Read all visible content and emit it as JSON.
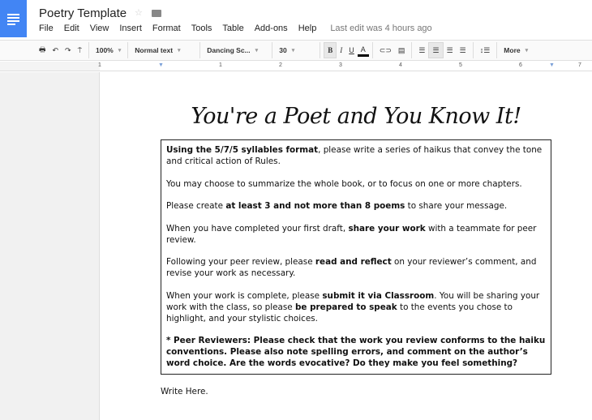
{
  "app": {
    "title": "Poetry Template",
    "last_edit": "Last edit was 4 hours ago"
  },
  "menu": [
    "File",
    "Edit",
    "View",
    "Insert",
    "Format",
    "Tools",
    "Table",
    "Add-ons",
    "Help"
  ],
  "toolbar": {
    "zoom": "100%",
    "style": "Normal text",
    "font": "Dancing Sc...",
    "size": "30",
    "bold": "B",
    "italic": "I",
    "underline": "U",
    "text_color": "A",
    "more": "More",
    "text_color_value": "#000000"
  },
  "ruler": [
    "1",
    "1",
    "2",
    "3",
    "4",
    "5",
    "6",
    "7"
  ],
  "doc": {
    "heading": "You're a Poet and You Know It!",
    "paragraphs": [
      [
        {
          "t": "Using the 5/7/5 syllables format",
          "b": true
        },
        {
          "t": ", please write a series of haikus that convey the tone and critical action of Rules."
        }
      ],
      [
        {
          "t": "You may choose to summarize the whole book, or to focus on one or more chapters."
        }
      ],
      [
        {
          "t": "Please create "
        },
        {
          "t": "at least 3 and not more than 8 poems",
          "b": true
        },
        {
          "t": " to share your message."
        }
      ],
      [
        {
          "t": "When you have completed your first draft, "
        },
        {
          "t": "share your work",
          "b": true
        },
        {
          "t": " with a teammate for peer review."
        }
      ],
      [
        {
          "t": "Following your peer review, please "
        },
        {
          "t": "read and reflect",
          "b": true
        },
        {
          "t": " on your reviewer’s comment, and revise your work as necessary."
        }
      ],
      [
        {
          "t": "When your work is complete, please "
        },
        {
          "t": "submit it via Classroom",
          "b": true
        },
        {
          "t": ". You will be sharing your work with the class, so please "
        },
        {
          "t": "be prepared to speak",
          "b": true
        },
        {
          "t": " to the events you chose to highlight, and your stylistic choices."
        }
      ],
      [
        {
          "t": "* Peer Reviewers: Please check that the work you review conforms to the haiku conventions. Please also note spelling errors, and comment on the author’s word choice. Are the words evocative? Do they make you feel something?",
          "b": true
        }
      ]
    ],
    "write_here": "Write Here."
  }
}
